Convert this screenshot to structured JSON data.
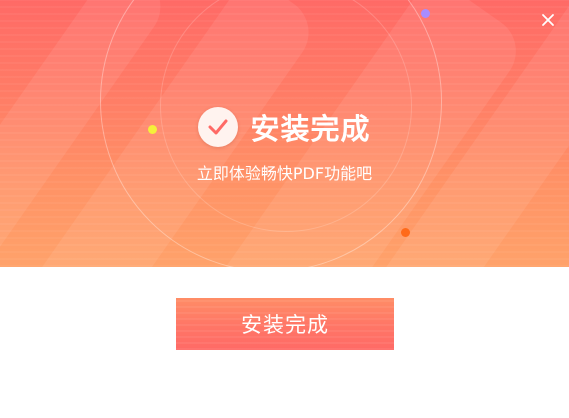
{
  "header": {
    "title": "安装完成",
    "subtitle": "立即体验畅快PDF功能吧",
    "status_icon": "check-icon",
    "close_icon": "close-icon"
  },
  "actions": {
    "finish_label": "安装完成"
  },
  "colors": {
    "banner_top": "#ff6a66",
    "banner_bottom": "#ffa26a",
    "button": "#ff7766",
    "check": "#ff6a66",
    "dot_yellow": "#f5f03a",
    "dot_purple": "#a88cff",
    "dot_orange": "#ff6a1a"
  }
}
